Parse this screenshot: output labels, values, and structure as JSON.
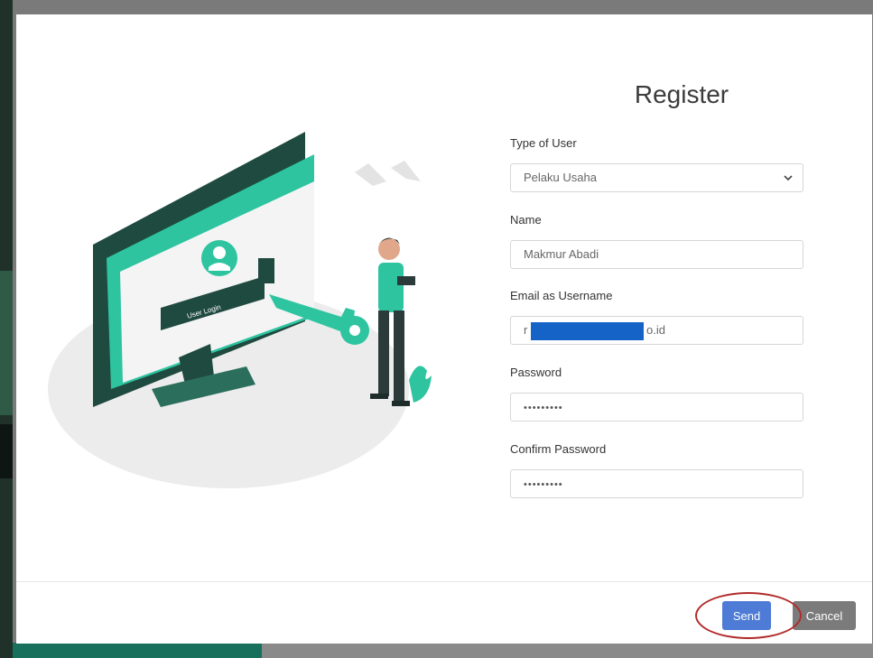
{
  "dialog": {
    "title": "Register",
    "illustration_text": "User Login"
  },
  "form": {
    "user_type": {
      "label": "Type of User",
      "selected": "Pelaku Usaha"
    },
    "name": {
      "label": "Name",
      "value": "Makmur Abadi"
    },
    "email": {
      "label": "Email as Username",
      "value_visible_start": "r",
      "value_visible_end": "o.id"
    },
    "password": {
      "label": "Password",
      "value": "•••••••••"
    },
    "confirm_password": {
      "label": "Confirm Password",
      "value": "•••••••••"
    }
  },
  "footer": {
    "send_label": "Send",
    "cancel_label": "Cancel"
  },
  "colors": {
    "accent": "#4d7bd5",
    "illustration_teal": "#2ec4a0",
    "redaction": "#1663c7",
    "highlight": "#b12c2c"
  }
}
